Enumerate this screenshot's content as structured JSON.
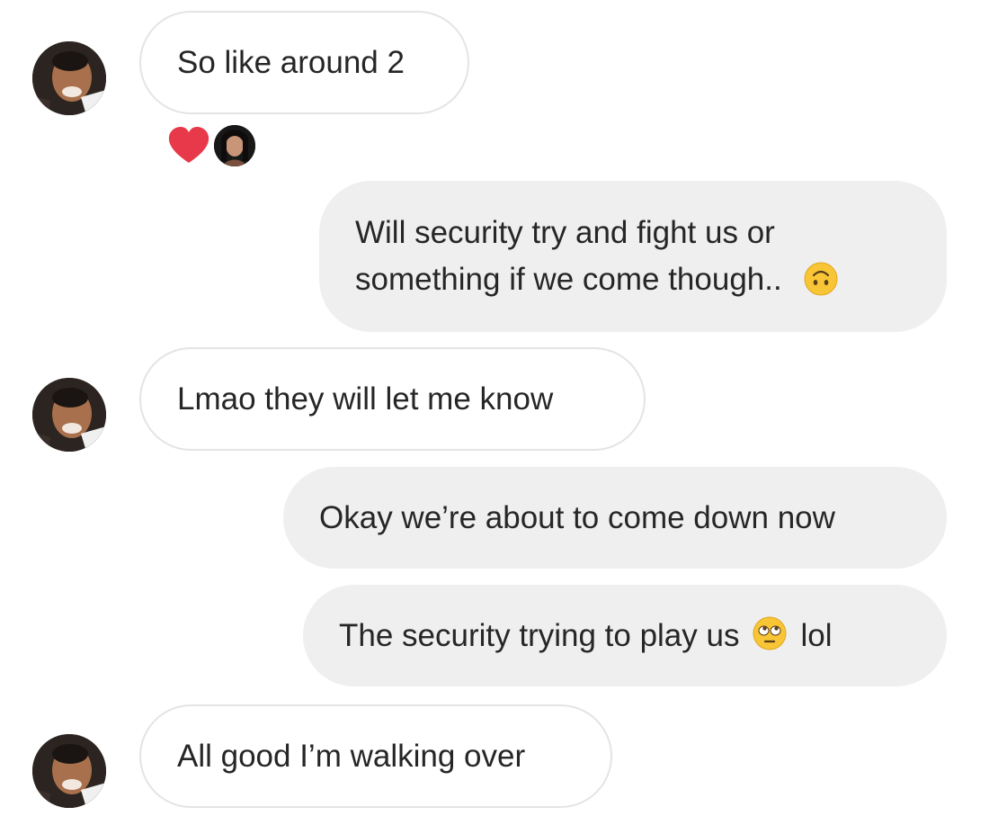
{
  "thread": {
    "messages": [
      {
        "sender": "them",
        "text": "So like around 2"
      },
      {
        "sender": "me",
        "text_line1": "Will security try and fight us or",
        "text_line2": "something if we come though..",
        "emoji": "upside-down-face-icon"
      },
      {
        "sender": "them",
        "text": "Lmao they will let me know"
      },
      {
        "sender": "me",
        "text": "Okay we’re about to come down now"
      },
      {
        "sender": "me",
        "text_before": "The security trying to play us",
        "emoji": "eye-roll-face-icon",
        "text_after": "lol"
      },
      {
        "sender": "them",
        "text": "All good I’m walking over"
      }
    ],
    "reaction": {
      "emoji": "heart-icon",
      "color": "#e8394b"
    }
  },
  "colors": {
    "incoming_bubble_bg": "#ffffff",
    "incoming_bubble_border": "#e4e4e4",
    "outgoing_bubble_bg": "#efefef",
    "text": "#262626"
  }
}
